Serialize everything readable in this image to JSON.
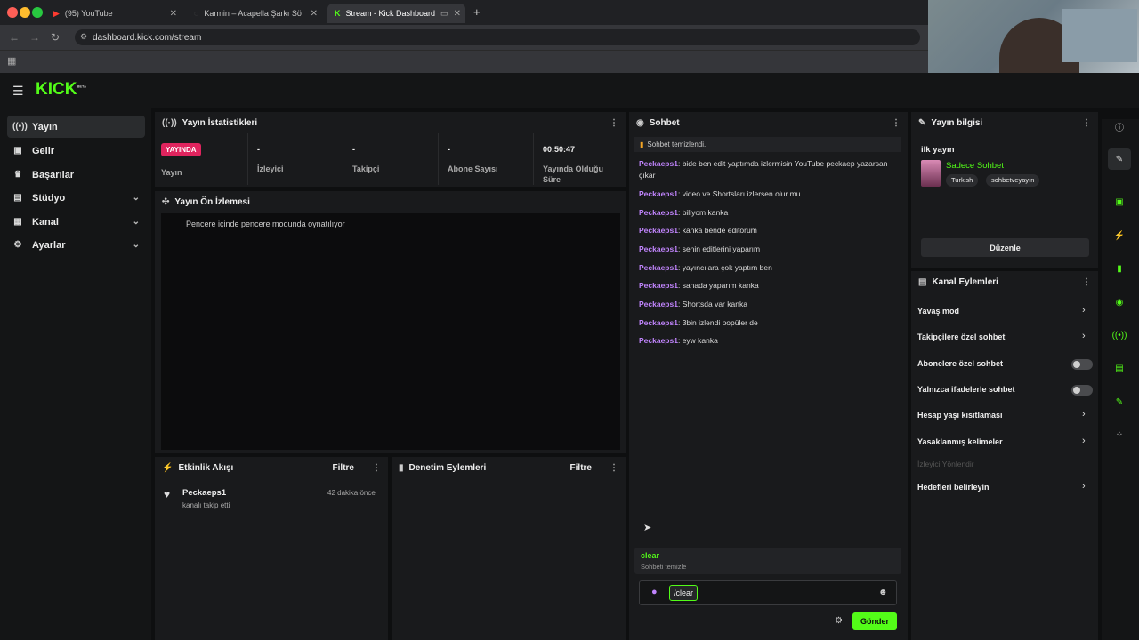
{
  "browser": {
    "tabs": [
      {
        "label": "(95) YouTube"
      },
      {
        "label": "Karmin – Acapella Şarkı Sözle"
      },
      {
        "label": "Stream - Kick Dashboard"
      }
    ],
    "url": "dashboard.kick.com/stream"
  },
  "brand": {
    "logo": "KICK",
    "beta": "BETA"
  },
  "sidebar": {
    "items": [
      {
        "label": "Yayın",
        "icon": "broadcast-icon"
      },
      {
        "label": "Gelir",
        "icon": "wallet-icon"
      },
      {
        "label": "Başarılar",
        "icon": "trophy-icon"
      },
      {
        "label": "Stüdyo",
        "icon": "studio-icon"
      },
      {
        "label": "Kanal",
        "icon": "channel-icon"
      },
      {
        "label": "Ayarlar",
        "icon": "gear-icon"
      }
    ]
  },
  "stats": {
    "title": "Yayın İstatistikleri",
    "live_badge": "YAYINDA",
    "live_label": "Yayın",
    "cells": [
      {
        "value": "-",
        "label": "İzleyici"
      },
      {
        "value": "-",
        "label": "Takipçi"
      },
      {
        "value": "-",
        "label": "Abone Sayısı"
      },
      {
        "value": "00:50:47",
        "label": "Yayında Olduğu Süre"
      }
    ]
  },
  "preview": {
    "title": "Yayın Ön İzlemesi",
    "pip_text": "Pencere içinde pencere modunda oynatılıyor"
  },
  "activity": {
    "title": "Etkinlik Akışı",
    "filter": "Filtre",
    "items": [
      {
        "user": "Peckaeps1",
        "action": "kanalı takip etti",
        "time": "42 dakika önce"
      }
    ]
  },
  "moderation": {
    "title": "Denetim Eylemleri",
    "filter": "Filtre"
  },
  "chat": {
    "title": "Sohbet",
    "cleared_notice": "Sohbet temizlendi.",
    "messages": [
      {
        "user": "Peckaeps1",
        "text": "bide ben edit yaptımda izlermisin YouTube peckaep yazarsan çıkar"
      },
      {
        "user": "Peckaeps1",
        "text": "video ve Shortsları izlersen olur mu"
      },
      {
        "user": "Peckaeps1",
        "text": "biliyom kanka"
      },
      {
        "user": "Peckaeps1",
        "text": "kanka bende editörüm"
      },
      {
        "user": "Peckaeps1",
        "text": "senin editlerini yaparım"
      },
      {
        "user": "Peckaeps1",
        "text": "yayıncılara çok yaptım ben"
      },
      {
        "user": "Peckaeps1",
        "text": "sanada yaparım kanka"
      },
      {
        "user": "Peckaeps1",
        "text": "Shortsda var kanka"
      },
      {
        "user": "Peckaeps1",
        "text": "3bin izlendi popüler de"
      },
      {
        "user": "Peckaeps1",
        "text": "eyw kanka"
      }
    ],
    "suggestion_cmd": "clear",
    "suggestion_desc": "Sohbeti temizle",
    "input_value": "/clear",
    "send": "Gönder"
  },
  "stream_info": {
    "title": "Yayın bilgisi",
    "stream_title": "ilk yayın",
    "category": "Sadece Sohbet",
    "tags": [
      "Turkish",
      "sohbetveyayın"
    ],
    "edit": "Düzenle"
  },
  "channel_actions": {
    "title": "Kanal Eylemleri",
    "rows": [
      {
        "label": "Yavaş mod",
        "kind": "arrow"
      },
      {
        "label": "Takipçilere özel sohbet",
        "kind": "arrow"
      },
      {
        "label": "Abonelere özel sohbet",
        "kind": "toggle",
        "on": false
      },
      {
        "label": "Yalnızca ifadelerle sohbet",
        "kind": "toggle",
        "on": false
      },
      {
        "label": "Hesap yaşı kısıtlaması",
        "kind": "arrow"
      },
      {
        "label": "Yasaklanmış kelimeler",
        "kind": "arrow"
      }
    ],
    "disabled_label": "İzleyici Yönlendir",
    "goals": "Hedefleri belirleyin"
  },
  "colors": {
    "accent": "#53fc18",
    "live": "#e0245e",
    "username": "#c084fc"
  }
}
